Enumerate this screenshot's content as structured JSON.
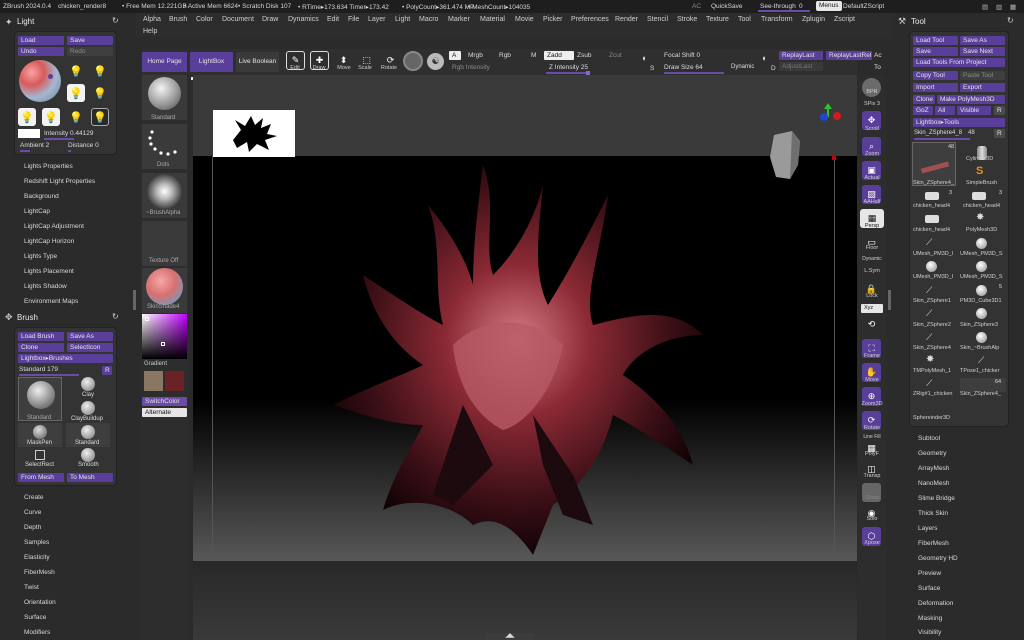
{
  "title_bar": {
    "app": "ZBrush 2024.0.4",
    "file": "chicken_render8",
    "free_mem": "• Free Mem 12.221GB",
    "active_mem": "• Active Mem 6624",
    "scratch": "• Scratch Disk 107",
    "rtime": "• RTime▸173.634 Timer▸173.42",
    "polycount": "• PolyCount▸361.474 MP",
    "meshcount": "• MeshCount▸104035",
    "ac": "AC",
    "quicksave": "QuickSave",
    "seethrough": "See-through",
    "seethrough_value": "0",
    "menus": "Menus",
    "zscript": "DefaultZScript"
  },
  "menu": [
    "Alpha",
    "Brush",
    "Color",
    "Document",
    "Draw",
    "Dynamics",
    "Edit",
    "File",
    "Layer",
    "Light",
    "Macro",
    "Marker",
    "Material",
    "Movie",
    "Picker",
    "Preferences",
    "Render",
    "Stencil",
    "Stroke",
    "Texture",
    "Tool",
    "Transform",
    "Zplugin",
    "Zscript"
  ],
  "menu_help": "Help",
  "toolbar": {
    "home_page": "Home Page",
    "lightbox": "LightBox",
    "live_boolean": "Live Boolean",
    "edit": "Edit",
    "draw": "Draw",
    "move": "Move",
    "scale": "Scale",
    "rotate": "Rotate",
    "a": "A",
    "mrgb": "Mrgb",
    "rgb": "Rgb",
    "m": "M",
    "zadd": "Zadd",
    "zsub": "Zsub",
    "zcut": "Zcut",
    "rgb_intensity": "Rgb Intensity",
    "z_intensity": "Z Intensity 25",
    "focal_shift": "Focal Shift 0",
    "draw_size": "Draw Size 64",
    "dynamic": "Dynamic",
    "replay_last": "ReplayLast",
    "replay_last_rel": "ReplayLastRel",
    "adjust_last": "AdjustLast",
    "s": "S",
    "d": "D",
    "ac": "Ac",
    "to": "To"
  },
  "light_panel": {
    "title": "Light",
    "load": "Load",
    "save": "Save",
    "undo": "Undo",
    "redo": "Redo",
    "intensity": "Intensity 0.44129",
    "ambient": "Ambient 2",
    "distance": "Distance 0",
    "items": [
      "Lights Properties",
      "Redshift Light Properties",
      "Background",
      "LightCap",
      "LightCap Adjustment",
      "LightCap Horizon",
      "Lights Type",
      "Lights Placement",
      "Lights Shadow",
      "Environment Maps"
    ]
  },
  "brush_panel": {
    "title": "Brush",
    "load_brush": "Load Brush",
    "save_as": "Save As",
    "clone": "Clone",
    "select_icon": "SelectIcon",
    "lightbox_brushes": "Lightbox▸Brushes",
    "standard_value": "Standard 179",
    "r": "R",
    "brushes": [
      "Standard",
      "Clay",
      "ClayBuildup",
      "MaskPen",
      "Standard",
      "SelectRect",
      "Smooth"
    ],
    "from_mesh": "From Mesh",
    "to_mesh": "To Mesh",
    "items": [
      "Create",
      "Curve",
      "Depth",
      "Samples",
      "Elasticity",
      "FiberMesh",
      "Twist",
      "Orientation",
      "Surface",
      "Modifiers"
    ]
  },
  "left_shelf": {
    "standard": "Standard",
    "dots": "Dots",
    "brush_alpha": "~BrushAlpha",
    "texture_off": "Texture Off",
    "skin_shade": "SkinShade4",
    "gradient": "Gradient",
    "switch_color": "SwitchColor",
    "alternate": "Alternate"
  },
  "right_shelf": [
    "BPR",
    "SPix 3",
    "Scroll",
    "Zoom",
    "Actual",
    "AAHalf",
    "Persp",
    "Floor",
    "Dynamic",
    "L.Sym",
    "Lock",
    "Xyz",
    "Frame",
    "Move",
    "Zoom3D",
    "Rotate",
    "Line Fill",
    "PolyF",
    "Transp",
    "Ghost",
    "Solo",
    "Xpose"
  ],
  "tool_panel": {
    "title": "Tool",
    "load_tool": "Load Tool",
    "save_as": "Save As",
    "save": "Save",
    "save_next": "Save Next",
    "load_from_project": "Load Tools From Project",
    "copy_tool": "Copy Tool",
    "paste_tool": "Paste Tool",
    "import": "Import",
    "export": "Export",
    "clone": "Clone",
    "make_polymesh": "Make PolyMesh3D",
    "goz": "GoZ",
    "all": "All",
    "visible": "Visible",
    "r": "R",
    "lightbox_tools": "Lightbox▸Tools",
    "current": "Skin_ZSphere4_8",
    "current_value": "48",
    "tools": [
      "Skin_ZSphere4_",
      "Cylinder3D",
      "SimpleBrush",
      "chicken_head4",
      "chicken_head4",
      "chicken_head4",
      "PolyMesh3D",
      "UMesh_PM3D_I",
      "UMesh_PM3D_S",
      "UMesh_PM3D_I",
      "UMesh_PM3D_S",
      "Skin_ZSphere1",
      "PM3D_Cube3D1",
      "Skin_ZSphere2",
      "Skin_ZSphere3",
      "Skin_ZSphere4",
      "Skin_~BrushAlp",
      "TMPolyMesh_1",
      "TPose1_chicker",
      "ZRig#1_chicken",
      "Skin_ZSphere4_",
      "Sphereinder3D"
    ],
    "tool_counts": [
      "48",
      "3",
      "3",
      "5",
      "64"
    ],
    "items": [
      "Subtool",
      "Geometry",
      "ArrayMesh",
      "NanoMesh",
      "Slime Bridge",
      "Thick Skin",
      "Layers",
      "FiberMesh",
      "Geometry HD",
      "Preview",
      "Surface",
      "Deformation",
      "Masking",
      "Visibility"
    ]
  },
  "colors": {
    "accent": "#6b4aa8",
    "panel": "#333333",
    "background": "#2b2b2b",
    "canvas": "#000000"
  }
}
